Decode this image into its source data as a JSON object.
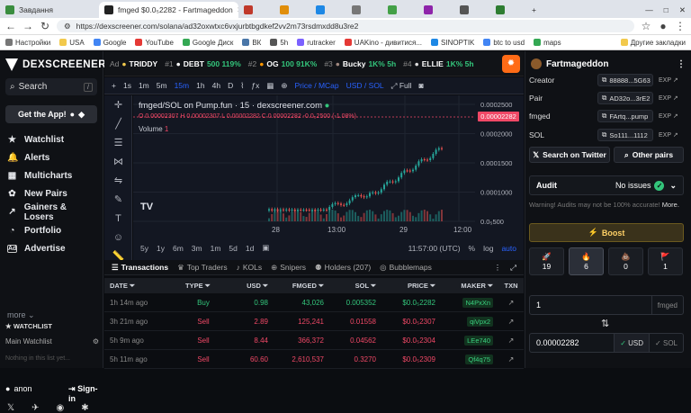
{
  "browser": {
    "tabs": [
      {
        "label": "Завдання",
        "color": "#3a8d3f"
      },
      {
        "label": "fmged $0.0₅2282 - Fartmageddon",
        "color": "#222222",
        "active": true
      },
      {
        "label": "",
        "color": "#c0392b"
      },
      {
        "label": "",
        "color": "#e08e0b"
      },
      {
        "label": "",
        "color": "#1e88e5"
      },
      {
        "label": "",
        "color": "#777777"
      },
      {
        "label": "",
        "color": "#43a047"
      },
      {
        "label": "",
        "color": "#8e24aa"
      },
      {
        "label": "",
        "color": "#555555"
      },
      {
        "label": "",
        "color": "#2e7d32"
      }
    ],
    "url": "https://dexscreener.com/solana/ad32oxwtxc6vxjurbtbgdkef2vv2m73rsdmxdd8u3re2",
    "bookmarks": [
      "Настройки",
      "USA",
      "Google",
      "YouTube",
      "Google Диск",
      "ВК",
      "5h",
      "rutracker",
      "UAKino - дивитися...",
      "SINOPTIK",
      "btc to usd",
      "maps",
      "Другие закладки"
    ]
  },
  "sidebar": {
    "brand": "DEXSCREENER",
    "search_label": "Search",
    "search_key": "/",
    "get_app": "Get the App!",
    "items": [
      {
        "label": "Watchlist",
        "icon": "★"
      },
      {
        "label": "Alerts",
        "icon": "🔔"
      },
      {
        "label": "Multicharts",
        "icon": "▦"
      },
      {
        "label": "New Pairs",
        "icon": "✿"
      },
      {
        "label": "Gainers & Losers",
        "icon": "↗"
      },
      {
        "label": "Portfolio",
        "icon": "◔"
      },
      {
        "label": "Advertise",
        "icon": "Ad"
      }
    ],
    "more": "more",
    "watchlist_title": "WATCHLIST",
    "main_watchlist": "Main Watchlist",
    "empty_text": "Nothing in this list yet...",
    "user": "anon",
    "sign_in": "Sign-in"
  },
  "ticker": [
    {
      "rank": "Ad",
      "sym": "TRIDDY",
      "pct": ""
    },
    {
      "rank": "#1",
      "sym": "DEBT",
      "pct": "500 119%"
    },
    {
      "rank": "#2",
      "sym": "OG",
      "pct": "100 91K%"
    },
    {
      "rank": "#3",
      "sym": "Bucky",
      "pct": "1K% 5h"
    },
    {
      "rank": "#4",
      "sym": "ELLIE",
      "pct": "1K% 5h"
    }
  ],
  "chart_toolbar": {
    "timeframes": [
      "1s",
      "1m",
      "5m",
      "15m",
      "1h",
      "4h",
      "D"
    ],
    "active_tf": "15m",
    "price_toggle": "Price / MCap",
    "currency_toggle": "USD / SOL",
    "full": "Full"
  },
  "chart_data": {
    "type": "candlestick",
    "title": "fmged/SOL on Pump.fun · 15 · dexscreener.com",
    "ohlc_label": "O 0.00002307 H 0.00002307 L 0.00002282 C 0.00002282 -0.0₅2500 (-1.08%)",
    "volume_label": "Volume",
    "volume_value": "1",
    "last_price": "0.00002282",
    "y_ticks": [
      "0.0002500",
      "0.0002000",
      "0.0001500",
      "0.0001000",
      "0.0₅500"
    ],
    "x_ticks": [
      "28",
      "13:00",
      "29",
      "12:00"
    ],
    "time_label": "11:57:00 (UTC)",
    "scale_labels": [
      "%",
      "log",
      "auto"
    ],
    "ranges": [
      "5y",
      "1y",
      "6m",
      "3m",
      "1m",
      "5d",
      "1d"
    ]
  },
  "tx_tabs": [
    "Transactions",
    "Top Traders",
    "KOLs",
    "Snipers",
    "Holders (207)",
    "Bubblemaps"
  ],
  "tx_columns": [
    "DATE",
    "TYPE",
    "USD",
    "FMGED",
    "SOL",
    "PRICE",
    "MAKER",
    "TXN"
  ],
  "transactions": [
    {
      "date": "1h 14m ago",
      "type": "Buy",
      "usd": "0.98",
      "fmged": "43,026",
      "sol": "0.005352",
      "price": "$0.0₅2282",
      "maker": "N4PxXn"
    },
    {
      "date": "3h 21m ago",
      "type": "Sell",
      "usd": "2.89",
      "fmged": "125,241",
      "sol": "0.01558",
      "price": "$0.0₅2307",
      "maker": "qiVpx2"
    },
    {
      "date": "5h 9m ago",
      "type": "Sell",
      "usd": "8.44",
      "fmged": "366,372",
      "sol": "0.04562",
      "price": "$0.0₅2304",
      "maker": "LEe740"
    },
    {
      "date": "5h 11m ago",
      "type": "Sell",
      "usd": "60.60",
      "fmged": "2,610,537",
      "sol": "0.3270",
      "price": "$0.0₅2309",
      "maker": "Qf4q75"
    }
  ],
  "right": {
    "title": "Fartmageddon",
    "info": [
      {
        "label": "Creator",
        "value": "88888...5G63"
      },
      {
        "label": "Pair",
        "value": "AD32o...3rE2"
      },
      {
        "label": "fmged",
        "value": "FArtq...pump"
      },
      {
        "label": "SOL",
        "value": "So111...1112"
      }
    ],
    "exp": "EXP",
    "search_twitter": "Search on Twitter",
    "other_pairs": "Other pairs",
    "audit_label": "Audit",
    "audit_value": "No issues",
    "warning": "Warning! Audits may not be 100% accurate!",
    "warning_more": "More.",
    "boost": "Boost",
    "reactions": [
      {
        "icon": "🚀",
        "count": "19"
      },
      {
        "icon": "🔥",
        "count": "6"
      },
      {
        "icon": "💩",
        "count": "0"
      },
      {
        "icon": "🚩",
        "count": "1"
      }
    ],
    "amount_value": "1",
    "amount_unit": "fmged",
    "converted_value": "0.00002282",
    "usd_unit": "USD",
    "sol_unit": "SOL"
  },
  "colors": {
    "buy": "#33c57b",
    "sell": "#f04866",
    "accent": "#2962ff"
  }
}
